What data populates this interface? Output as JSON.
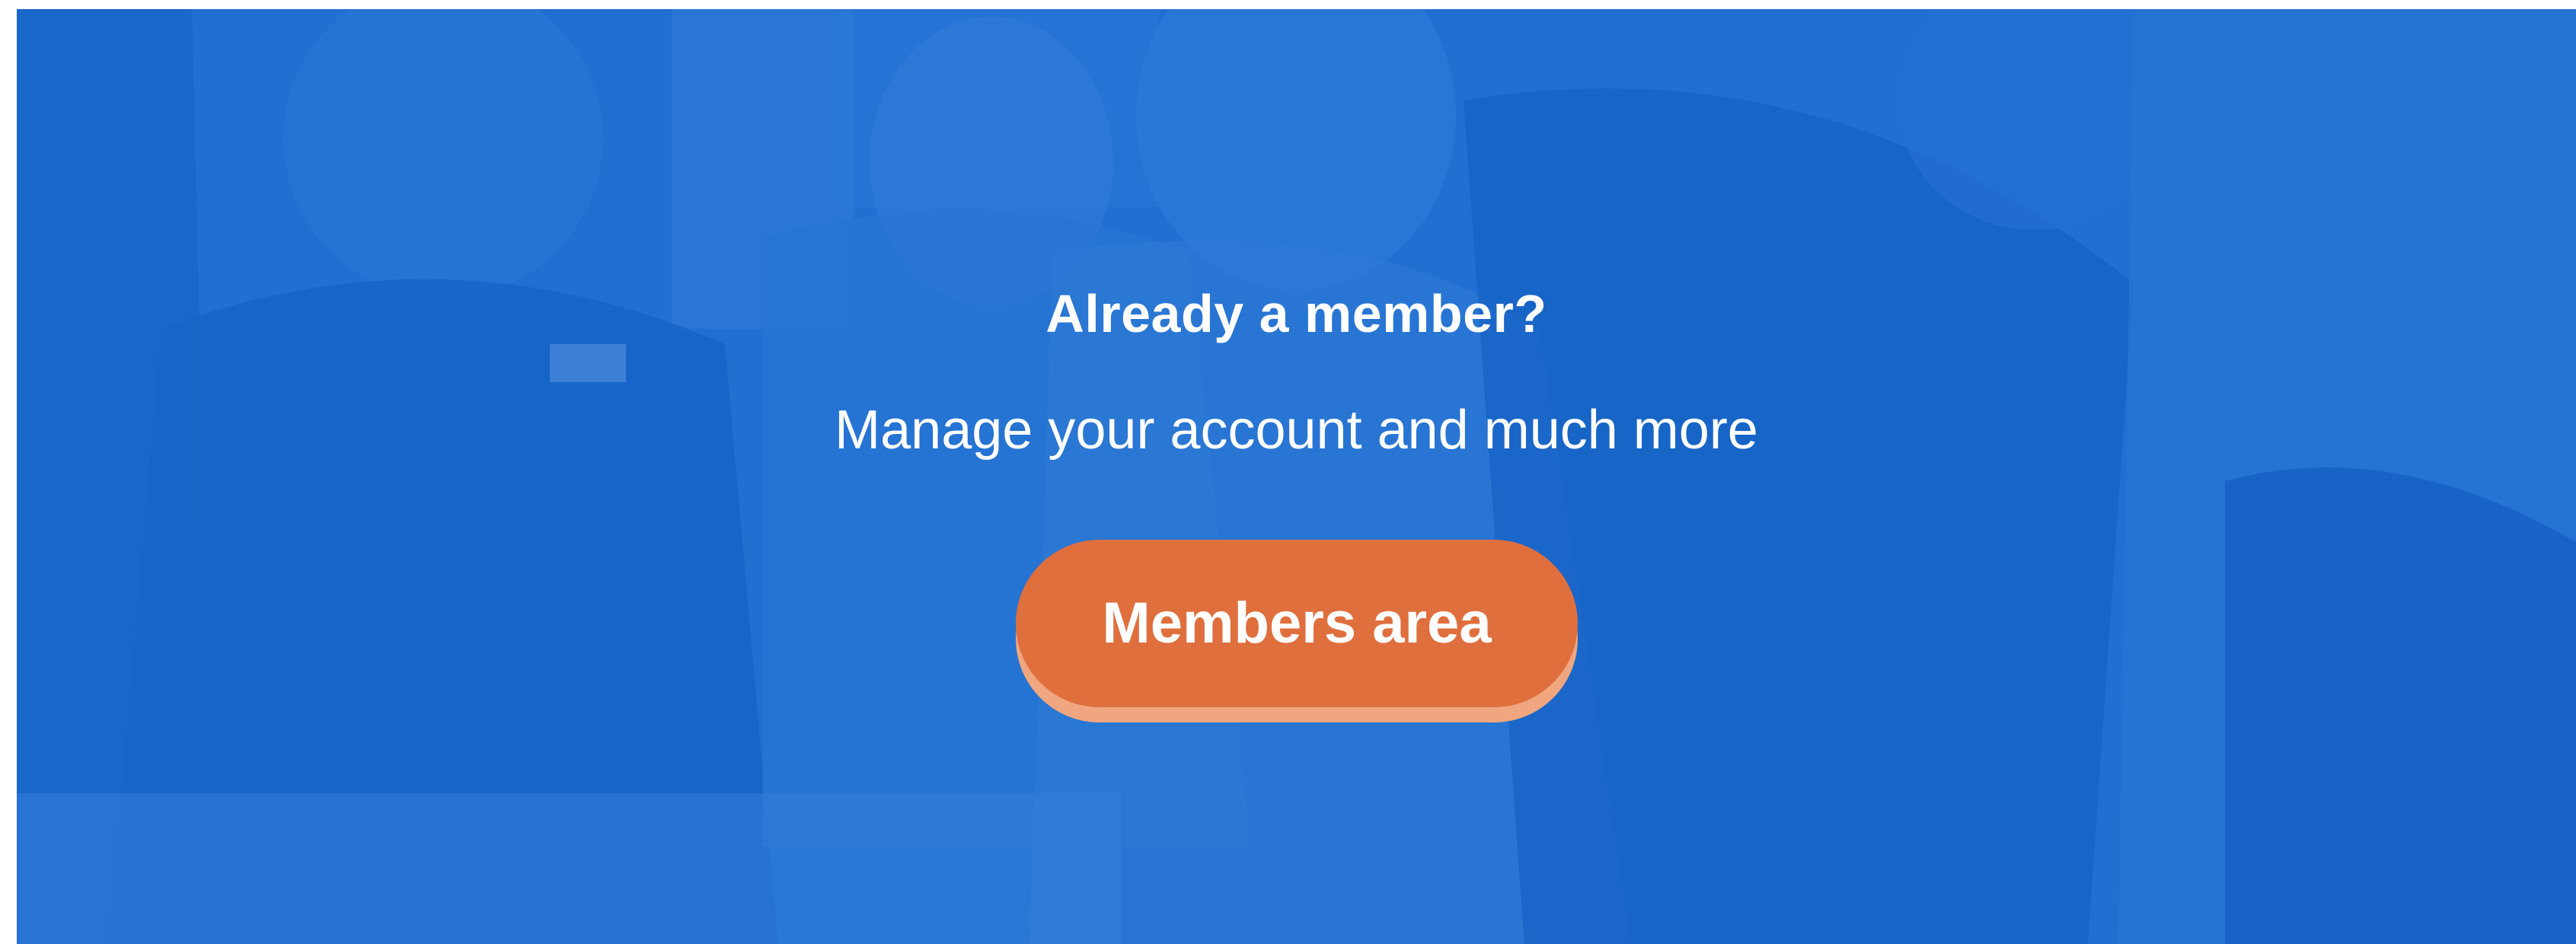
{
  "banner": {
    "heading": "Already a member?",
    "subheading": "Manage your account and much more",
    "cta_label": "Members area",
    "background_image": "group-of-people-photo",
    "colors": {
      "overlay": "#1f6dd0",
      "cta": "#e06f3e",
      "cta_shadow": "#f0a780",
      "text": "#ffffff"
    }
  }
}
